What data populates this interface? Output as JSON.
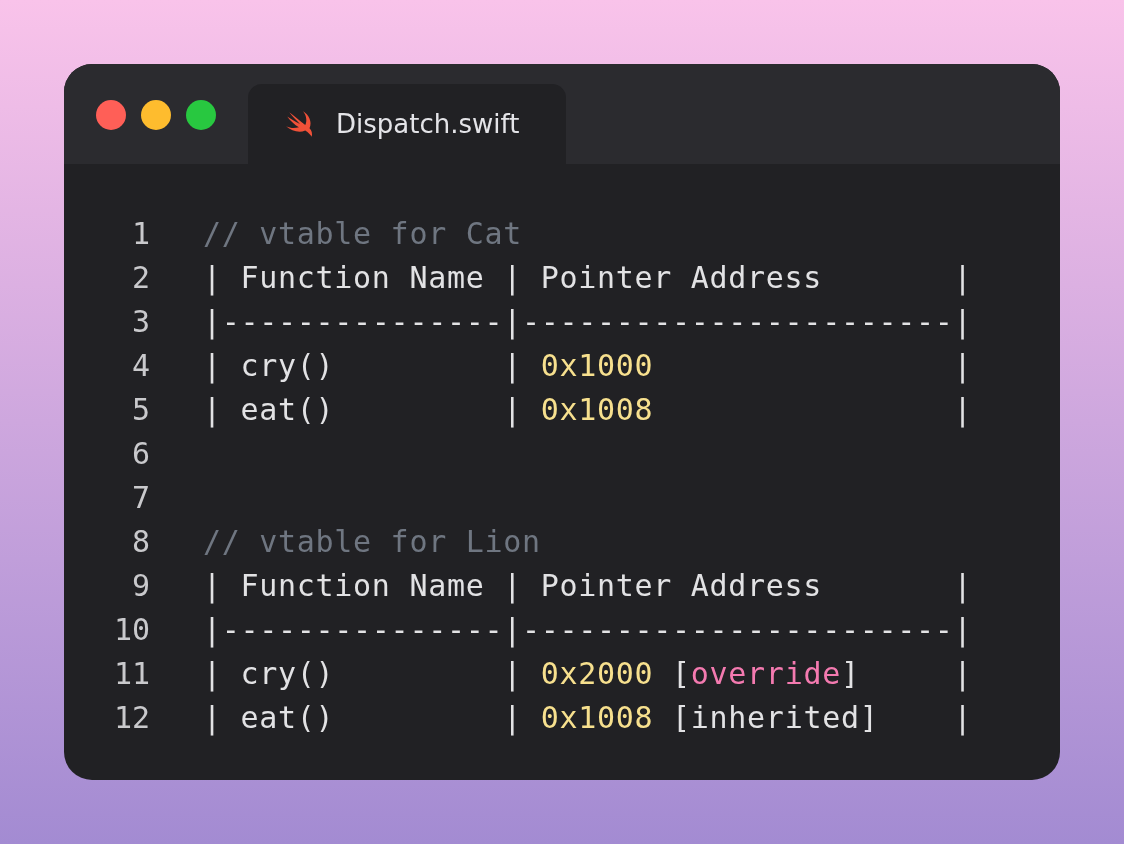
{
  "window": {
    "traffic_lights": [
      {
        "color": "#ff5f57"
      },
      {
        "color": "#febc2e"
      },
      {
        "color": "#28c840"
      }
    ]
  },
  "tab": {
    "label": "Dispatch.swift",
    "selected": true
  },
  "lines": [
    {
      "number": "1",
      "tokens": [
        {
          "kind": "comment",
          "text": "// vtable for Cat"
        }
      ]
    },
    {
      "number": "2",
      "tokens": [
        {
          "kind": "plain",
          "text": "| Function Name | Pointer Address       |"
        }
      ]
    },
    {
      "number": "3",
      "tokens": [
        {
          "kind": "plain",
          "text": "|---------------|-----------------------|"
        }
      ]
    },
    {
      "number": "4",
      "tokens": [
        {
          "kind": "plain",
          "text": "| cry()         | "
        },
        {
          "kind": "number",
          "text": "0x1000"
        },
        {
          "kind": "plain",
          "text": "                |"
        }
      ]
    },
    {
      "number": "5",
      "tokens": [
        {
          "kind": "plain",
          "text": "| eat()         | "
        },
        {
          "kind": "number",
          "text": "0x1008"
        },
        {
          "kind": "plain",
          "text": "                |"
        }
      ]
    },
    {
      "number": "6"
    },
    {
      "number": "7"
    },
    {
      "number": "8",
      "tokens": [
        {
          "kind": "comment",
          "text": "// vtable for Lion"
        }
      ]
    },
    {
      "number": "9",
      "tokens": [
        {
          "kind": "plain",
          "text": "| Function Name | Pointer Address       |"
        }
      ]
    },
    {
      "number": "10",
      "tokens": [
        {
          "kind": "plain",
          "text": "|---------------|-----------------------|"
        }
      ]
    },
    {
      "number": "11",
      "tokens": [
        {
          "kind": "plain",
          "text": "| cry()         | "
        },
        {
          "kind": "number",
          "text": "0x2000"
        },
        {
          "kind": "plain",
          "text": " ["
        },
        {
          "kind": "keyword",
          "text": "override"
        },
        {
          "kind": "plain",
          "text": "]     |"
        }
      ]
    },
    {
      "number": "12",
      "tokens": [
        {
          "kind": "plain",
          "text": "| eat()         | "
        },
        {
          "kind": "number",
          "text": "0x1008"
        },
        {
          "kind": "plain",
          "text": " [inherited]    |"
        }
      ]
    }
  ]
}
